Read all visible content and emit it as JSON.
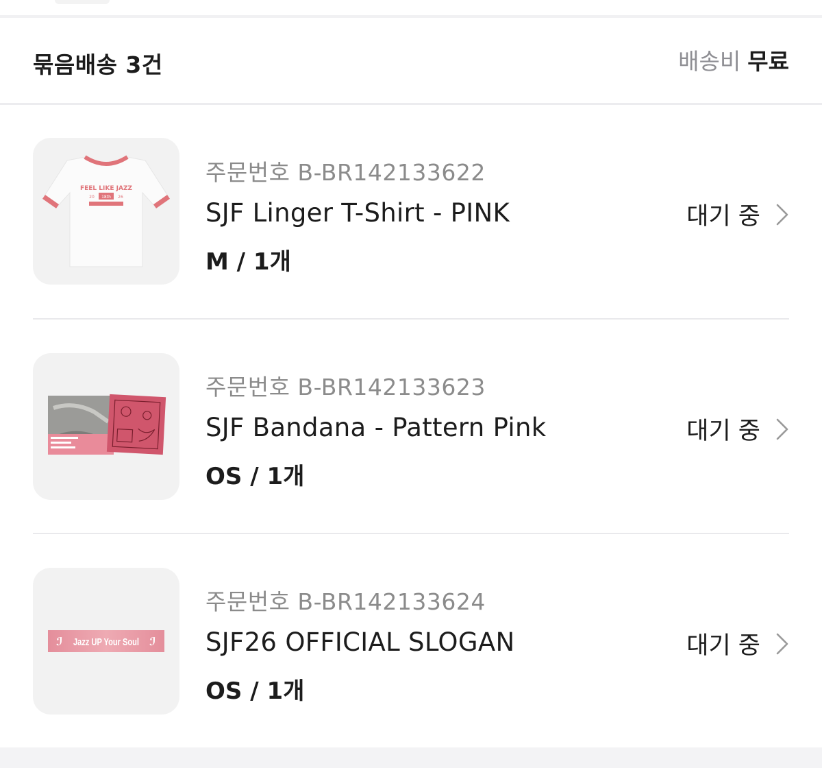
{
  "header": {
    "title": "묶음배송 3건",
    "shipping_label": "배송비",
    "shipping_value": "무료"
  },
  "items": [
    {
      "order_label": "주문번호 B-BR142133622",
      "name": "SJF Linger T-Shirt - PINK",
      "option": "M / 1개",
      "status": "대기 중",
      "image_icon": "tshirt-thumbnail",
      "image_text": [
        "FEEL LIKE JAZZ",
        "20",
        "18th",
        "26"
      ]
    },
    {
      "order_label": "주문번호 B-BR142133623",
      "name": "SJF Bandana - Pattern Pink",
      "option": "OS / 1개",
      "status": "대기 중",
      "image_icon": "bandana-thumbnail"
    },
    {
      "order_label": "주문번호 B-BR142133624",
      "name": "SJF26 OFFICIAL SLOGAN",
      "option": "OS / 1개",
      "status": "대기 중",
      "image_icon": "slogan-thumbnail",
      "image_text": [
        "Jazz UP Your Soul"
      ]
    }
  ],
  "colors": {
    "accent_pink": "#e0747a",
    "muted_text": "#8b8b8b",
    "thumb_bg": "#f2f2f2"
  }
}
